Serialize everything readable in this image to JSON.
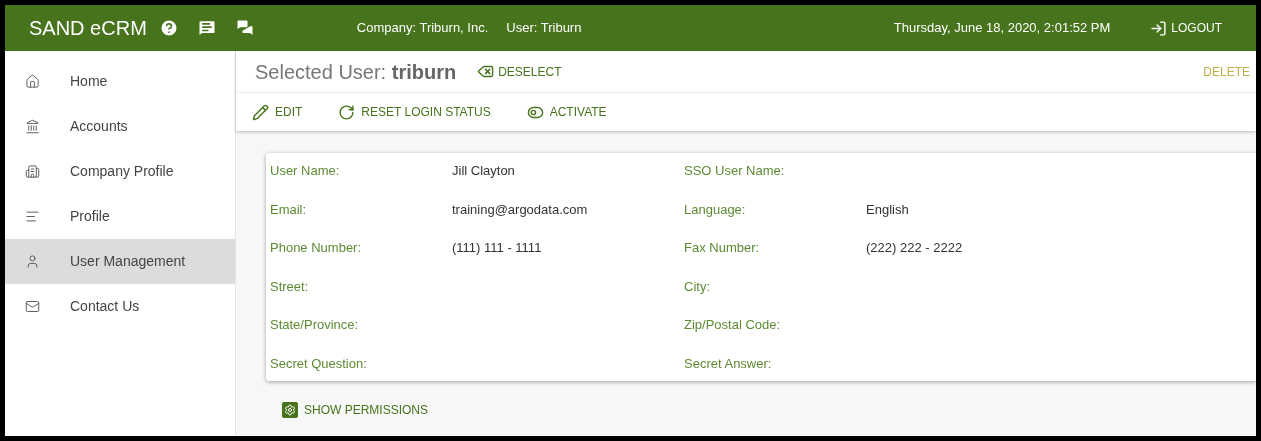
{
  "header": {
    "app_title": "SAND eCRM",
    "company": "Company: Triburn, Inc.",
    "user": "User: Triburn",
    "datetime": "Thursday, June 18, 2020, 2:01:52 PM",
    "logout": "LOGOUT"
  },
  "sidebar": {
    "items": [
      {
        "label": "Home",
        "selected": false
      },
      {
        "label": "Accounts",
        "selected": false
      },
      {
        "label": "Company Profile",
        "selected": false
      },
      {
        "label": "Profile",
        "selected": false
      },
      {
        "label": "User Management",
        "selected": true
      },
      {
        "label": "Contact Us",
        "selected": false
      }
    ]
  },
  "selected_user": {
    "prefix": "Selected User:",
    "name": "triburn",
    "deselect": "DESELECT",
    "delete": "DELETE"
  },
  "toolbar": [
    {
      "label": "EDIT"
    },
    {
      "label": "RESET LOGIN STATUS"
    },
    {
      "label": "ACTIVATE"
    }
  ],
  "details": [
    {
      "label": "User Name:",
      "value": "Jill Clayton"
    },
    {
      "label": "SSO User Name:"
    },
    {
      "label": "Email:",
      "value": "training@argodata.com"
    },
    {
      "label": "Language:",
      "value": "English"
    },
    {
      "label": "Phone Number:",
      "value": "(111) 111 - 1111"
    },
    {
      "label": "Fax Number:",
      "value": "(222) 222 - 2222"
    },
    {
      "label": "Street:"
    },
    {
      "label": "City:"
    },
    {
      "label": "State/Province:"
    },
    {
      "label": "Zip/Postal Code:"
    },
    {
      "label": "Secret Question:"
    },
    {
      "label": "Secret Answer:"
    }
  ],
  "show_permissions": "SHOW PERMISSIONS"
}
